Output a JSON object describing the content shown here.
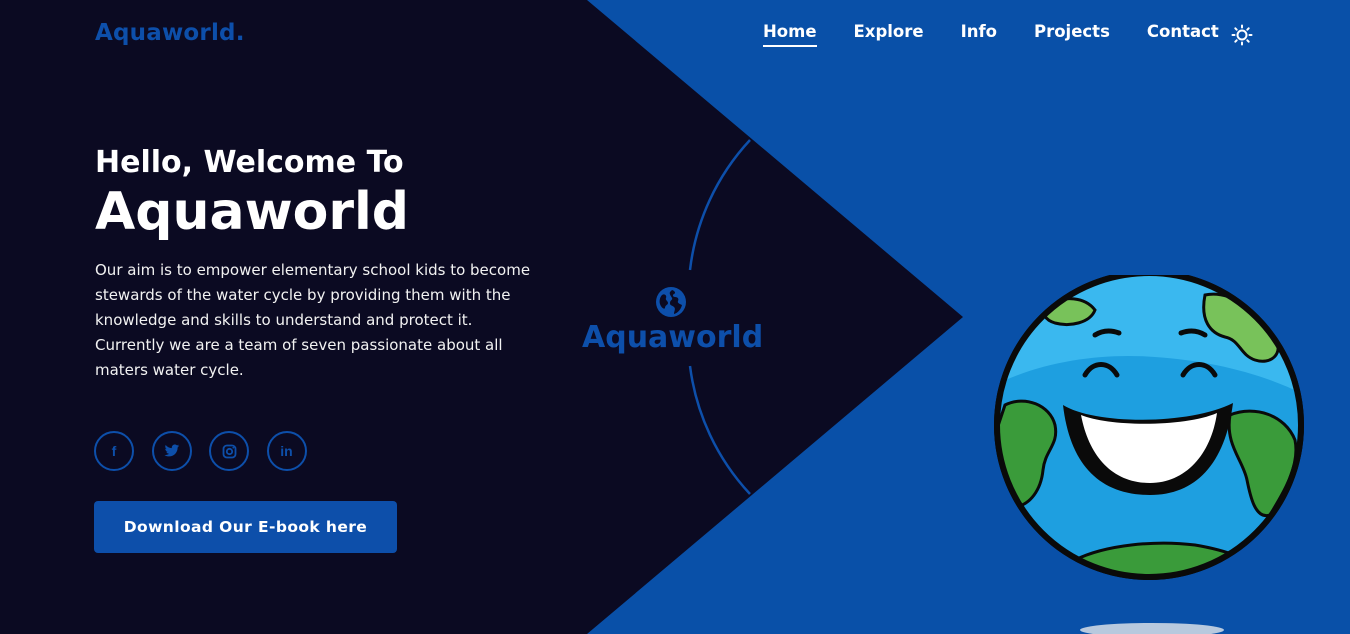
{
  "header": {
    "logo": "Aquaworld.",
    "nav": [
      {
        "label": "Home",
        "active": true
      },
      {
        "label": "Explore",
        "active": false
      },
      {
        "label": "Info",
        "active": false
      },
      {
        "label": "Projects",
        "active": false
      },
      {
        "label": "Contact",
        "active": false
      }
    ],
    "theme_icon": "sun-icon"
  },
  "hero": {
    "subtitle": "Hello, Welcome To",
    "title": "Aquaworld",
    "description_1": "Our aim is to empower elementary school kids to become stewards of the water cycle by providing them with the knowledge and skills to understand and protect it.",
    "description_2": "Currently we are a team of seven passionate about all maters water cycle.",
    "socials": [
      {
        "icon": "facebook-icon",
        "glyph": "f"
      },
      {
        "icon": "twitter-icon",
        "glyph": ""
      },
      {
        "icon": "instagram-icon",
        "glyph": ""
      },
      {
        "icon": "linkedin-icon",
        "glyph": "in"
      }
    ],
    "cta_label": "Download Our E-book here"
  },
  "center_brand": {
    "icon": "globe-icon",
    "label": "Aquaworld"
  },
  "illustration": {
    "icon": "smiling-earth-illustration"
  },
  "colors": {
    "dark_bg": "#0b0a22",
    "blue_bg": "#0950a8",
    "accent": "#0d4faa",
    "text": "#ffffff"
  }
}
